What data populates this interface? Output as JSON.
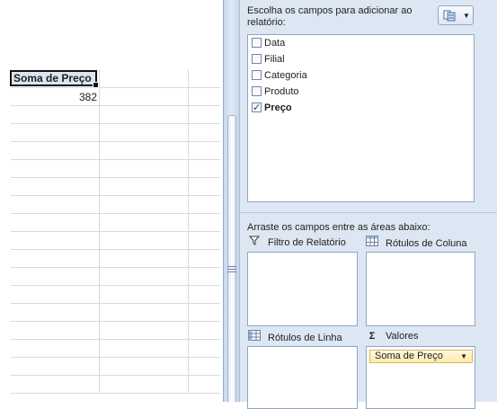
{
  "sheet": {
    "pivot_header": "Soma de Preço",
    "pivot_value": "382"
  },
  "field_list": {
    "choose_label": "Escolha os campos para adicionar ao relatório:",
    "layout_button_icon": "field-list-layout-icon",
    "fields": [
      {
        "label": "Data",
        "checked": false
      },
      {
        "label": "Filial",
        "checked": false
      },
      {
        "label": "Categoria",
        "checked": false
      },
      {
        "label": "Produto",
        "checked": false
      },
      {
        "label": "Preço",
        "checked": true
      }
    ],
    "drag_label": "Arraste os campos entre as áreas abaixo:",
    "areas": {
      "report_filter": {
        "label": "Filtro de Relatório",
        "icon": "filter-icon"
      },
      "column_labels": {
        "label": "Rótulos de Coluna",
        "icon": "column-grid-icon"
      },
      "row_labels": {
        "label": "Rótulos de Linha",
        "icon": "row-grid-icon"
      },
      "values": {
        "label": "Valores",
        "icon": "sigma-icon",
        "items": [
          "Soma de Preço"
        ]
      }
    }
  },
  "colors": {
    "panel_bg": "#dde7f3",
    "selected_value_bg": "#ffeaa8"
  }
}
